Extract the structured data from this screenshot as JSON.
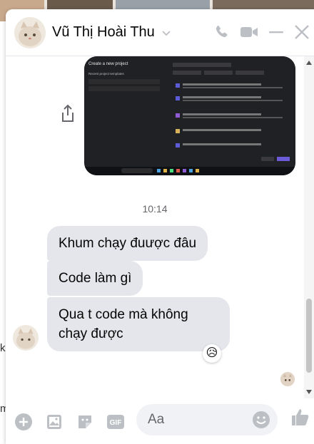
{
  "header": {
    "name": "Vũ Thị Hoài Thu",
    "icons": [
      "phone-icon",
      "video-icon",
      "minimize-icon",
      "close-icon"
    ]
  },
  "attachment": {
    "kind": "screenshot",
    "screen_title": "Create a new project",
    "recent_label": "Recent project templates"
  },
  "time_divider": "10:14",
  "messages": [
    {
      "text": "Khum chạy đuược đâu"
    },
    {
      "text": "Code làm gì"
    },
    {
      "text": "Qua t code mà không chạy được",
      "reaction": "😥"
    }
  ],
  "composer": {
    "placeholder": "Aa"
  },
  "background_fragments": [
    "k",
    "m"
  ],
  "colors": {
    "accent": "#0084ff",
    "bubble": "#e4e6eb",
    "icon": "#bcc0c4"
  }
}
